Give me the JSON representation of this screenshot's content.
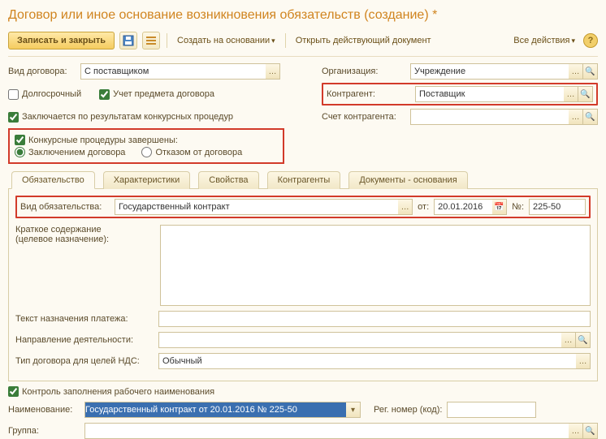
{
  "title": "Договор или иное основание возникновения обязательств (создание) *",
  "toolbar": {
    "save_close": "Записать и закрыть",
    "create_based": "Создать на основании",
    "open_doc": "Открыть действующий документ",
    "all_actions": "Все действия",
    "help": "?"
  },
  "fields": {
    "contract_type_label": "Вид договора:",
    "contract_type_value": "С поставщиком",
    "org_label": "Организация:",
    "org_value": "Учреждение",
    "longterm": "Долгосрочный",
    "subject_accounting": "Учет предмета договора",
    "counterparty_label": "Контрагент:",
    "counterparty_value": "Поставщик",
    "by_tender": "Заключается по результатам конкурсных процедур",
    "account_label": "Счет контрагента:",
    "procedures_done": "Конкурсные процедуры завершены:",
    "by_contract": "Заключением договора",
    "by_refusal": "Отказом от договора"
  },
  "tabs": [
    "Обязательство",
    "Характеристики",
    "Свойства",
    "Контрагенты",
    "Документы - основания"
  ],
  "oblig": {
    "kind_label": "Вид обязательства:",
    "kind_value": "Государственный контракт",
    "date_label": "от:",
    "date_value": "20.01.2016",
    "num_label": "№:",
    "num_value": "225-50",
    "summary_label1": "Краткое содержание",
    "summary_label2": "(целевое назначение):",
    "payment_text_label": "Текст назначения платежа:",
    "activity_label": "Направление деятельности:",
    "vat_type_label": "Тип договора для целей НДС:",
    "vat_type_value": "Обычный"
  },
  "footer": {
    "control_naming": "Контроль заполнения рабочего наименования",
    "name_label": "Наименование:",
    "name_value": "Государственный контракт от 20.01.2016 № 225-50",
    "regnum_label": "Рег. номер (код):",
    "group_label": "Группа:"
  }
}
